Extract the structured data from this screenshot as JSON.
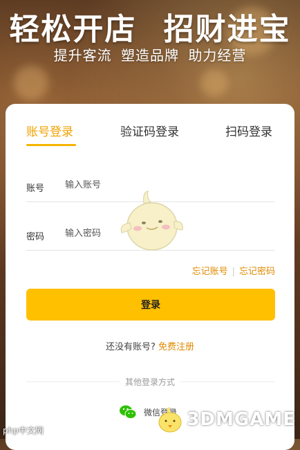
{
  "hero": {
    "title": "轻松开店 招财进宝",
    "subtitle": "提升客流 塑造品牌 助力经营"
  },
  "tabs": [
    {
      "label": "账号登录",
      "active": true
    },
    {
      "label": "验证码登录",
      "active": false
    },
    {
      "label": "扫码登录",
      "active": false
    }
  ],
  "form": {
    "account": {
      "label": "账号",
      "placeholder": "输入账号",
      "value": ""
    },
    "password": {
      "label": "密码",
      "placeholder": "输入密码",
      "value": ""
    },
    "forgot_account": "忘记账号",
    "forgot_password": "忘记密码",
    "login_button": "登录"
  },
  "register": {
    "prompt": "还没有账号?",
    "link": "免费注册"
  },
  "other_login": {
    "heading": "其他登录方式",
    "wechat_label": "微信登录"
  },
  "watermarks": {
    "left": "php中文网",
    "right": "3DMGAME"
  },
  "colors": {
    "accent": "#ffc000",
    "link": "#e08a00",
    "wechat": "#2dc100"
  },
  "icons": [
    "wechat-icon",
    "mascot-chick-icon"
  ]
}
